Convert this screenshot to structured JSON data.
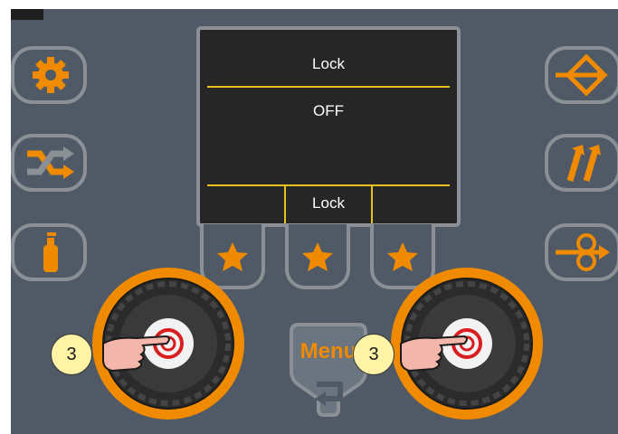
{
  "screen": {
    "title": "Lock",
    "value": "OFF",
    "softkeys": [
      "",
      "Lock",
      ""
    ]
  },
  "left_buttons": [
    {
      "icon": "gear-icon"
    },
    {
      "icon": "shuffle-icon"
    },
    {
      "icon": "gas-bottle-icon"
    }
  ],
  "right_buttons": [
    {
      "icon": "wire-feed-icon"
    },
    {
      "icon": "two-step-icon"
    },
    {
      "icon": "wire-inch-icon"
    }
  ],
  "favorite_buttons": [
    {
      "icon": "star-icon"
    },
    {
      "icon": "star-icon"
    },
    {
      "icon": "star-icon"
    }
  ],
  "menu": {
    "label": "Menu",
    "icon": "return-arrow-icon"
  },
  "step_markers": [
    "3",
    "3"
  ],
  "colors": {
    "panel": "#4f5a66",
    "accent": "#f08a00",
    "screen_bg": "#262626",
    "screen_lines": "#e6c21a",
    "badge": "#fff4a6"
  }
}
